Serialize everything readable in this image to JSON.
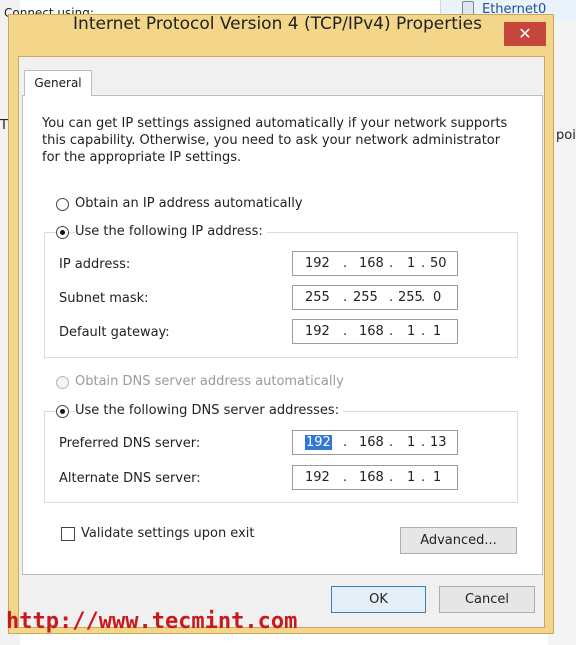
{
  "background": {
    "top_left_text": "Connect using:",
    "ethernet_label": "Ethernet0",
    "left_edge_text": "T",
    "right_edge_text": "poi"
  },
  "dialog": {
    "title": "Internet Protocol Version 4 (TCP/IPv4) Properties",
    "close_label": "✕",
    "tab_general": "General",
    "intro": "You can get IP settings assigned automatically if your network supports this capability. Otherwise, you need to ask your network administrator for the appropriate IP settings.",
    "ip_auto_label": "Obtain an IP address automatically",
    "ip_manual_label": "Use the following IP address:",
    "ip_mode": "manual",
    "fields": {
      "ip_address": {
        "label": "IP address:",
        "octets": [
          "192",
          "168",
          "1",
          "50"
        ]
      },
      "subnet_mask": {
        "label": "Subnet mask:",
        "octets": [
          "255",
          "255",
          "255",
          "0"
        ]
      },
      "default_gateway": {
        "label": "Default gateway:",
        "octets": [
          "192",
          "168",
          "1",
          "1"
        ]
      }
    },
    "dns_auto_label": "Obtain DNS server address automatically",
    "dns_manual_label": "Use the following DNS server addresses:",
    "dns_mode": "manual",
    "dns": {
      "preferred": {
        "label": "Preferred DNS server:",
        "octets": [
          "192",
          "168",
          "1",
          "13"
        ]
      },
      "alternate": {
        "label": "Alternate DNS server:",
        "octets": [
          "192",
          "168",
          "1",
          "1"
        ]
      }
    },
    "validate_label": "Validate settings upon exit",
    "validate_checked": false,
    "advanced_label": "Advanced...",
    "ok_label": "OK",
    "cancel_label": "Cancel"
  },
  "watermark": "http://www.tecmint.com",
  "colors": {
    "frame": "#f3d68a",
    "close": "#c7463c",
    "selection": "#3178d4",
    "watermark": "#c81a1a"
  }
}
